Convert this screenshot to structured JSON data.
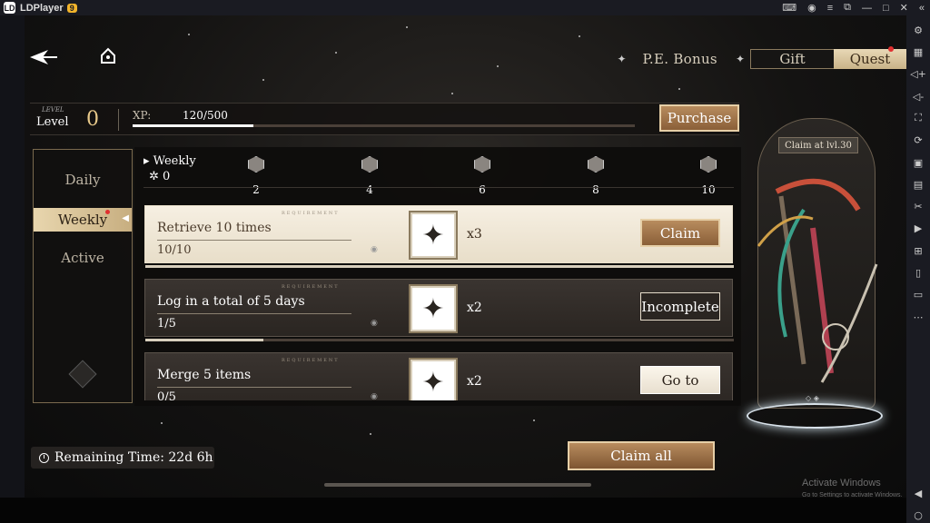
{
  "window": {
    "app_name": "LDPlayer",
    "version_badge": "9",
    "title_icons": [
      "gamepad-icon",
      "user-icon",
      "menu-icon",
      "restore-icon",
      "minimize-icon",
      "maximize-icon",
      "close-icon",
      "collapse-icon"
    ]
  },
  "sidebar_icons": [
    "settings-icon",
    "keyboard-icon",
    "volume-up-icon",
    "volume-down-icon",
    "screenshot-icon",
    "sync-icon",
    "record-icon",
    "apk-icon",
    "scissors-icon",
    "media-icon",
    "scale-icon",
    "shake-icon",
    "folder-icon",
    "more-icon",
    "back-icon",
    "circle-home-icon"
  ],
  "top_tabs": {
    "pe_bonus": "P.E. Bonus",
    "gift": "Gift",
    "quest": "Quest"
  },
  "level": {
    "small_label": "LEVEL",
    "label": "Level",
    "value": "0",
    "xp_label": "XP:",
    "xp_current": 120,
    "xp_max": 500,
    "xp_text": "120/500"
  },
  "purchase_label": "Purchase",
  "side_tabs": {
    "daily": "Daily",
    "weekly": "Weekly",
    "active": "Active"
  },
  "weekly": {
    "title": "Weekly",
    "count": "0",
    "milestones": [
      "2",
      "4",
      "6",
      "8",
      "10"
    ]
  },
  "quests": [
    {
      "title": "Retrieve 10 times",
      "progress": "10/10",
      "progress_fraction": 1.0,
      "multiplier": "x3",
      "button": "Claim",
      "state": "done",
      "req_label": "REQUIREMENT"
    },
    {
      "title": "Log in a total of 5 days",
      "progress": "1/5",
      "progress_fraction": 0.2,
      "multiplier": "x2",
      "button": "Incomplete",
      "state": "incomplete",
      "req_label": "REQUIREMENT"
    },
    {
      "title": "Merge 5 items",
      "progress": "0/5",
      "progress_fraction": 0.0,
      "multiplier": "x2",
      "button": "Go to",
      "state": "goto",
      "req_label": "REQUIREMENT"
    }
  ],
  "reward": {
    "label": "Claim at lvl.30"
  },
  "remaining_time": "Remaining Time: 22d 6h",
  "claim_all_label": "Claim all",
  "watermark": {
    "line1": "Activate Windows",
    "line2": "Go to Settings to activate Windows."
  }
}
